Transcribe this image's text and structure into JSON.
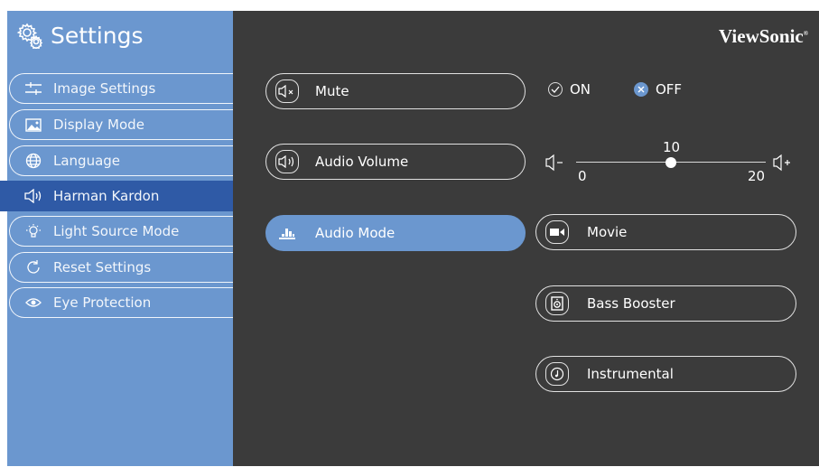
{
  "sidebar": {
    "title": "Settings",
    "items": [
      {
        "label": "Image Settings",
        "icon": "sliders-icon"
      },
      {
        "label": "Display Mode",
        "icon": "picture-icon"
      },
      {
        "label": "Language",
        "icon": "globe-icon"
      },
      {
        "label": "Harman Kardon",
        "icon": "speaker-icon",
        "active": true
      },
      {
        "label": "Light Source Mode",
        "icon": "bulb-icon"
      },
      {
        "label": "Reset Settings",
        "icon": "reset-icon"
      },
      {
        "label": "Eye Protection",
        "icon": "eye-icon"
      }
    ]
  },
  "brand": {
    "name": "ViewSonic",
    "mark": "®"
  },
  "mute": {
    "label": "Mute",
    "on_label": "ON",
    "off_label": "OFF",
    "selected": "OFF"
  },
  "audio_volume": {
    "label": "Audio Volume",
    "value": "10",
    "min": "0",
    "max": "20"
  },
  "audio_mode": {
    "label": "Audio Mode",
    "options": [
      {
        "label": "Movie",
        "icon": "camera-icon"
      },
      {
        "label": "Bass Booster",
        "icon": "speaker-cone-icon"
      },
      {
        "label": "Instrumental",
        "icon": "music-note-icon"
      }
    ]
  },
  "colors": {
    "sidebar": "#6b97cf",
    "active": "#2f5aa6",
    "panel": "#3b3b3b",
    "accent": "#6b97cf"
  }
}
